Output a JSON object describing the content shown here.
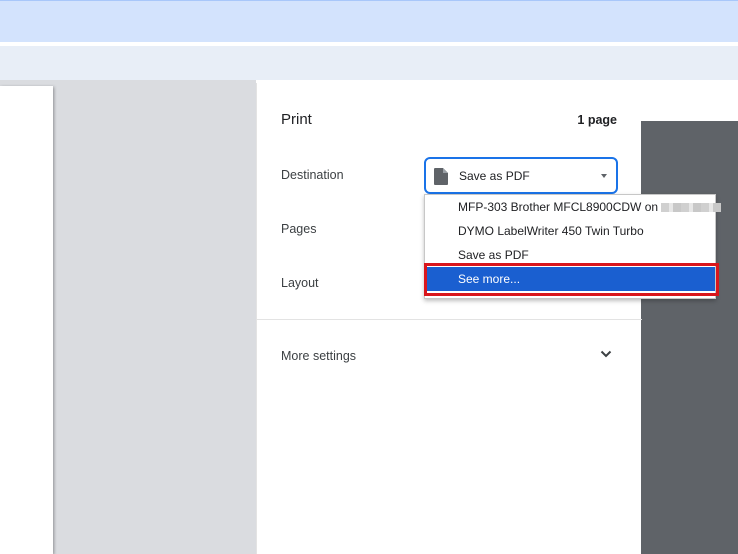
{
  "print": {
    "title": "Print",
    "page_count": "1 page",
    "destination_label": "Destination",
    "destination_value": "Save as PDF",
    "pages_label": "Pages",
    "layout_label": "Layout",
    "more_settings_label": "More settings",
    "destination_options": [
      {
        "label": "MFP-303 Brother MFCL8900CDW on"
      },
      {
        "label": "DYMO LabelWriter 450 Twin Turbo"
      },
      {
        "label": "Save as PDF"
      },
      {
        "label": "See more..."
      }
    ],
    "selected_option": "See more...",
    "highlight_color": "#d9161c",
    "accent_color": "#1a73e8"
  },
  "icons": {
    "file": "file-icon",
    "caret": "caret-down-icon",
    "chevron": "chevron-down-icon"
  }
}
